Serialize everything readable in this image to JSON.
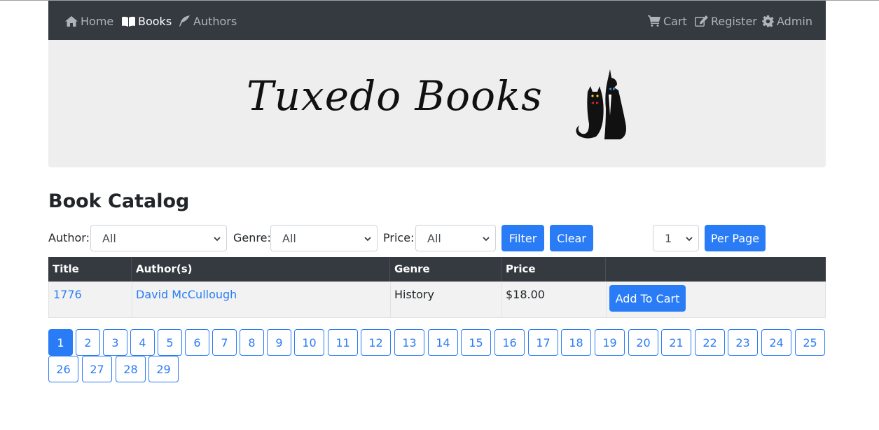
{
  "nav": {
    "home": "Home",
    "books": "Books",
    "authors": "Authors",
    "cart": "Cart",
    "register": "Register",
    "admin": "Admin"
  },
  "banner": {
    "logo_text": "Tuxedo Books"
  },
  "page": {
    "title": "Book Catalog"
  },
  "filters": {
    "author_label": "Author:",
    "author_value": "All",
    "genre_label": "Genre:",
    "genre_value": "All",
    "price_label": "Price:",
    "price_value": "All",
    "filter_button": "Filter",
    "clear_button": "Clear",
    "per_page_value": "1",
    "per_page_button": "Per Page"
  },
  "table": {
    "headers": [
      "Title",
      "Author(s)",
      "Genre",
      "Price",
      ""
    ],
    "rows": [
      {
        "title": "1776",
        "author": "David McCullough",
        "genre": "History",
        "price": "$18.00",
        "action": "Add To Cart"
      }
    ]
  },
  "pagination": {
    "current": "1",
    "pages": [
      "1",
      "2",
      "3",
      "4",
      "5",
      "6",
      "7",
      "8",
      "9",
      "10",
      "11",
      "12",
      "13",
      "14",
      "15",
      "16",
      "17",
      "18",
      "19",
      "20",
      "21",
      "22",
      "23",
      "24",
      "25",
      "26",
      "27",
      "28",
      "29"
    ]
  },
  "colors": {
    "navbar": "#343a40",
    "primary": "#2a7cf6",
    "banner": "#eeeeee"
  }
}
